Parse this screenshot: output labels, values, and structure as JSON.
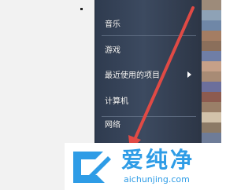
{
  "menu": {
    "items": [
      {
        "label": "音乐"
      },
      {
        "label": "游戏"
      },
      {
        "label": "最近使用的项目"
      },
      {
        "label": "计算机"
      },
      {
        "label": "网络"
      }
    ]
  },
  "logo": {
    "text": "爱纯净",
    "url": "aichunjing.com"
  },
  "colors": {
    "menu_bg": "#2f3b4f",
    "accent_arrow": "#e04a45",
    "logo_blue": "#2e9ce6"
  }
}
